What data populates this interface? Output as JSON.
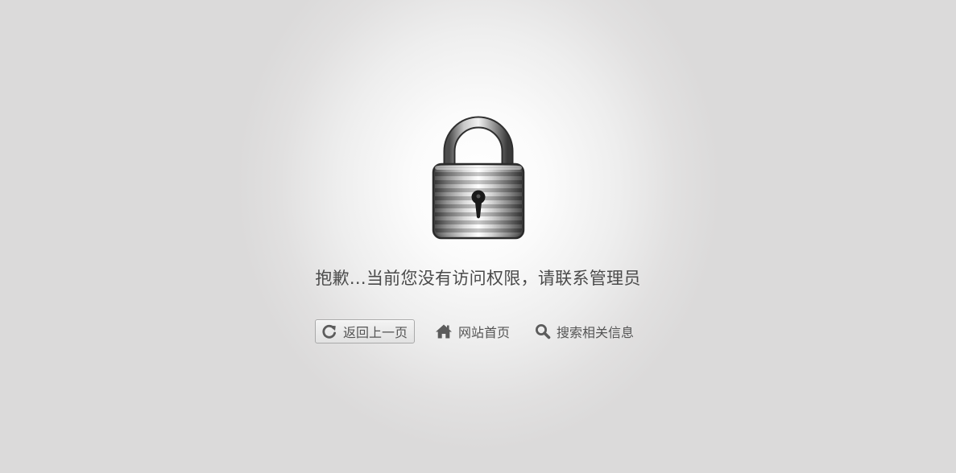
{
  "message": "抱歉...当前您没有访问权限，请联系管理员",
  "actions": {
    "back_label": "返回上一页",
    "home_label": "网站首页",
    "search_label": "搜索相关信息"
  },
  "icons": {
    "lock": "padlock-icon",
    "back": "refresh-arrow-icon",
    "home": "home-icon",
    "search": "magnifier-icon"
  },
  "colors": {
    "text": "#4a4a4a",
    "button_text": "#555555",
    "button_border": "#a9a9a9",
    "icon": "#5c5c5c"
  }
}
